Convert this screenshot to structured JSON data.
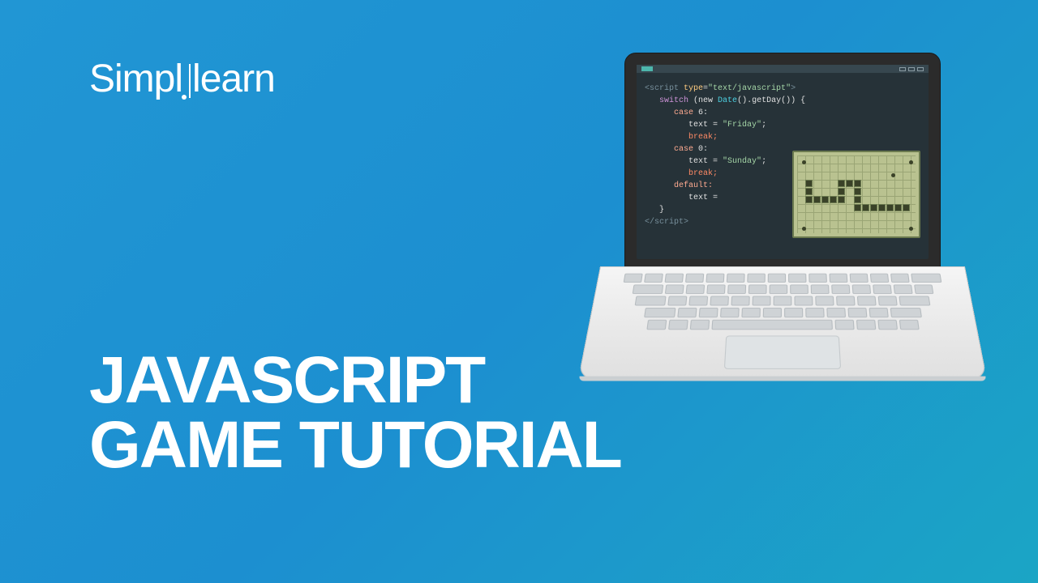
{
  "logo": {
    "part1": "Simpl",
    "part2": "learn"
  },
  "headline": {
    "line1": "JAVASCRIPT",
    "line2": "GAME TUTORIAL"
  },
  "code": {
    "l1_open": "<script",
    "l1_attr": " type",
    "l1_eq": "=",
    "l1_val": "\"text/javascript\"",
    "l1_close": ">",
    "l2_kw": "switch",
    "l2_rest": " (new ",
    "l2_fn": "Date",
    "l2_rest2": "().getDay()) {",
    "l3_kw": "case",
    "l3_val": " 6:",
    "l4_var": "text",
    "l4_eq": " = ",
    "l4_str": "\"Friday\"",
    "l4_semi": ";",
    "l5": "break;",
    "l6_kw": "case",
    "l6_val": " 0:",
    "l7_var": "text",
    "l7_eq": " = ",
    "l7_str": "\"Sunday\"",
    "l7_semi": ";",
    "l8": "break;",
    "l9": "default:",
    "l10_var": "text",
    "l10_eq": " =",
    "l11": "}",
    "l12": "</script>"
  }
}
